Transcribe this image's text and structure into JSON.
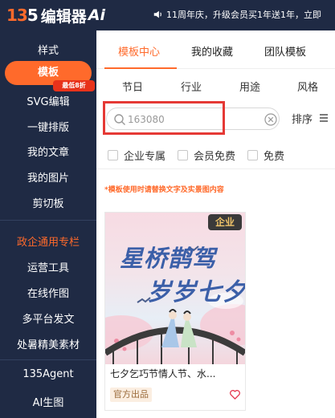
{
  "header": {
    "logo_mark_a": "13",
    "logo_mark_b": "5",
    "logo_text": "编辑器",
    "logo_ai": "Ai",
    "announcement": "11周年庆，升级会员买1年送1年，立即"
  },
  "sidebar": {
    "items": [
      {
        "label": "样式"
      },
      {
        "label": "模板"
      },
      {
        "label": "SVG编辑"
      },
      {
        "label": "一键排版"
      },
      {
        "label": "我的文章"
      },
      {
        "label": "我的图片"
      },
      {
        "label": "剪切板"
      },
      {
        "label": "政企通用专栏"
      },
      {
        "label": "运营工具"
      },
      {
        "label": "在线作图"
      },
      {
        "label": "多平台发文"
      },
      {
        "label": "处暑精美素材"
      },
      {
        "label": "135Agent"
      },
      {
        "label": "AI生图"
      }
    ],
    "badge": "最低8折"
  },
  "main": {
    "tabs": [
      "模板中心",
      "我的收藏",
      "团队模板"
    ],
    "categories": [
      "节日",
      "行业",
      "用途",
      "风格"
    ],
    "search": {
      "value": "163080"
    },
    "sort_label": "排序",
    "filters": [
      "企业专属",
      "会员免费",
      "免费"
    ],
    "notice": "*模板使用时请替换文字及实景图内容",
    "card": {
      "tag": "企业",
      "poster_line1": "星桥鹊驾",
      "poster_line2": "岁岁七夕",
      "title": "七夕乞巧节情人节、水...",
      "badge": "官方出品"
    }
  },
  "colors": {
    "sidebar_bg": "#1f2a44",
    "accent": "#ff6a2b",
    "highlight_box": "#e53935"
  }
}
